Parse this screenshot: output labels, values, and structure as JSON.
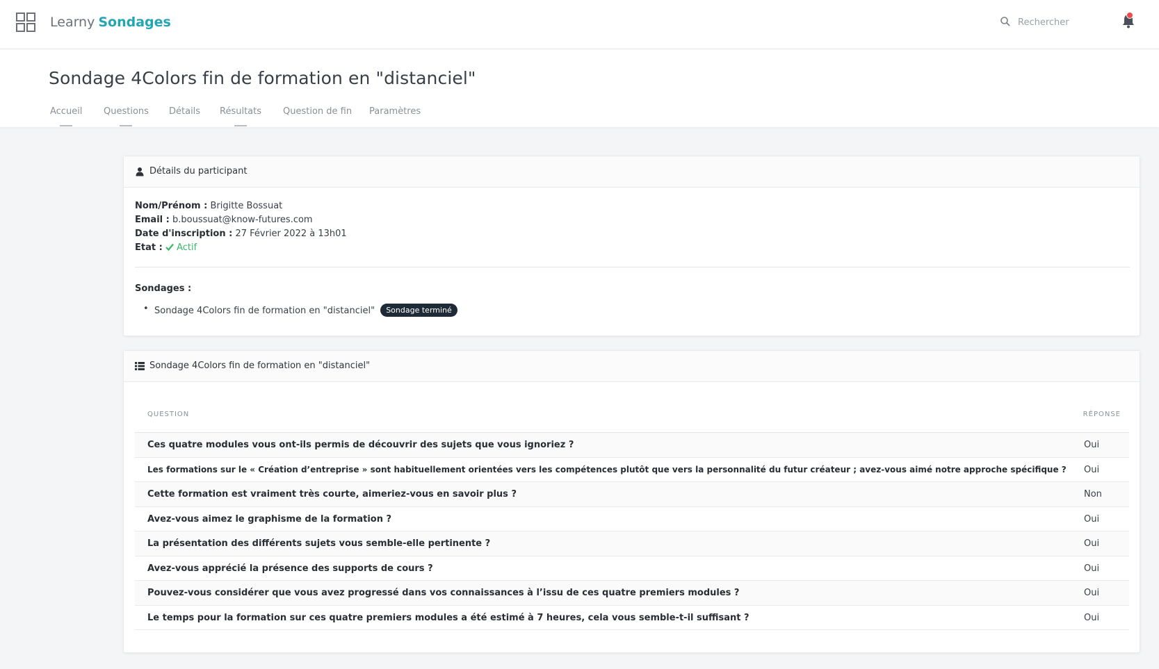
{
  "app": {
    "name_prefix": "Learny",
    "name_section": "Sondages"
  },
  "search": {
    "placeholder": "Rechercher"
  },
  "page": {
    "title": "Sondage 4Colors fin de formation en \"distanciel\""
  },
  "tabs": [
    {
      "label": "Accueil",
      "underlined": true
    },
    {
      "label": "Questions",
      "underlined": true
    },
    {
      "label": "Détails",
      "underlined": false
    },
    {
      "label": "Résultats",
      "underlined": true
    },
    {
      "label": "Question de fin",
      "underlined": false
    },
    {
      "label": "Paramètres",
      "underlined": false
    }
  ],
  "participant_card": {
    "title": "Détails du participant",
    "fields": {
      "name_label": "Nom/Prénom :",
      "name_value": "Brigitte Bossuat",
      "email_label": "Email :",
      "email_value": "b.boussuat@know-futures.com",
      "date_label": "Date d'inscription :",
      "date_value": "27 Février 2022 à 13h01",
      "state_label": "Etat :",
      "state_value": "Actif"
    },
    "sondages_label": "Sondages :",
    "sondages": [
      {
        "name": "Sondage 4Colors fin de formation en \"distanciel\"",
        "badge": "Sondage terminé"
      }
    ]
  },
  "results_card": {
    "title": "Sondage 4Colors fin de formation en \"distanciel\"",
    "columns": {
      "question": "QUESTION",
      "answer": "RÉPONSE"
    },
    "rows": [
      {
        "question": "Ces quatre modules vous ont-ils permis de découvrir des sujets que vous ignoriez ?",
        "answer": "Oui"
      },
      {
        "question": "Les formations sur le « Création d’entreprise » sont habituellement orientées vers les compétences plutôt que vers la personnalité du futur créateur ; avez-vous aimé notre approche spécifique ?",
        "answer": "Oui"
      },
      {
        "question": "Cette formation est vraiment très courte, aimeriez-vous en savoir plus ?",
        "answer": "Non"
      },
      {
        "question": "Avez-vous aimez le graphisme de la formation ?",
        "answer": "Oui"
      },
      {
        "question": "La présentation des différents sujets vous semble-elle pertinente ?",
        "answer": "Oui"
      },
      {
        "question": "Avez-vous apprécié la présence des supports de cours ?",
        "answer": "Oui"
      },
      {
        "question": "Pouvez-vous considérer que vous avez progressé dans vos connaissances à l’issu de ces quatre premiers modules ?",
        "answer": "Oui"
      },
      {
        "question": "Le temps pour la formation sur ces quatre premiers modules a été estimé à 7 heures, cela vous semble-t-il suffisant ?",
        "answer": "Oui"
      }
    ]
  },
  "colors": {
    "brand": "#22a6b3",
    "active": "#38b865",
    "badge_bg": "#1f2a37",
    "notification": "#ef4b4b"
  },
  "icons": [
    "apps-grid-icon",
    "search-icon",
    "bell-icon",
    "user-icon",
    "list-icon",
    "check-icon"
  ]
}
